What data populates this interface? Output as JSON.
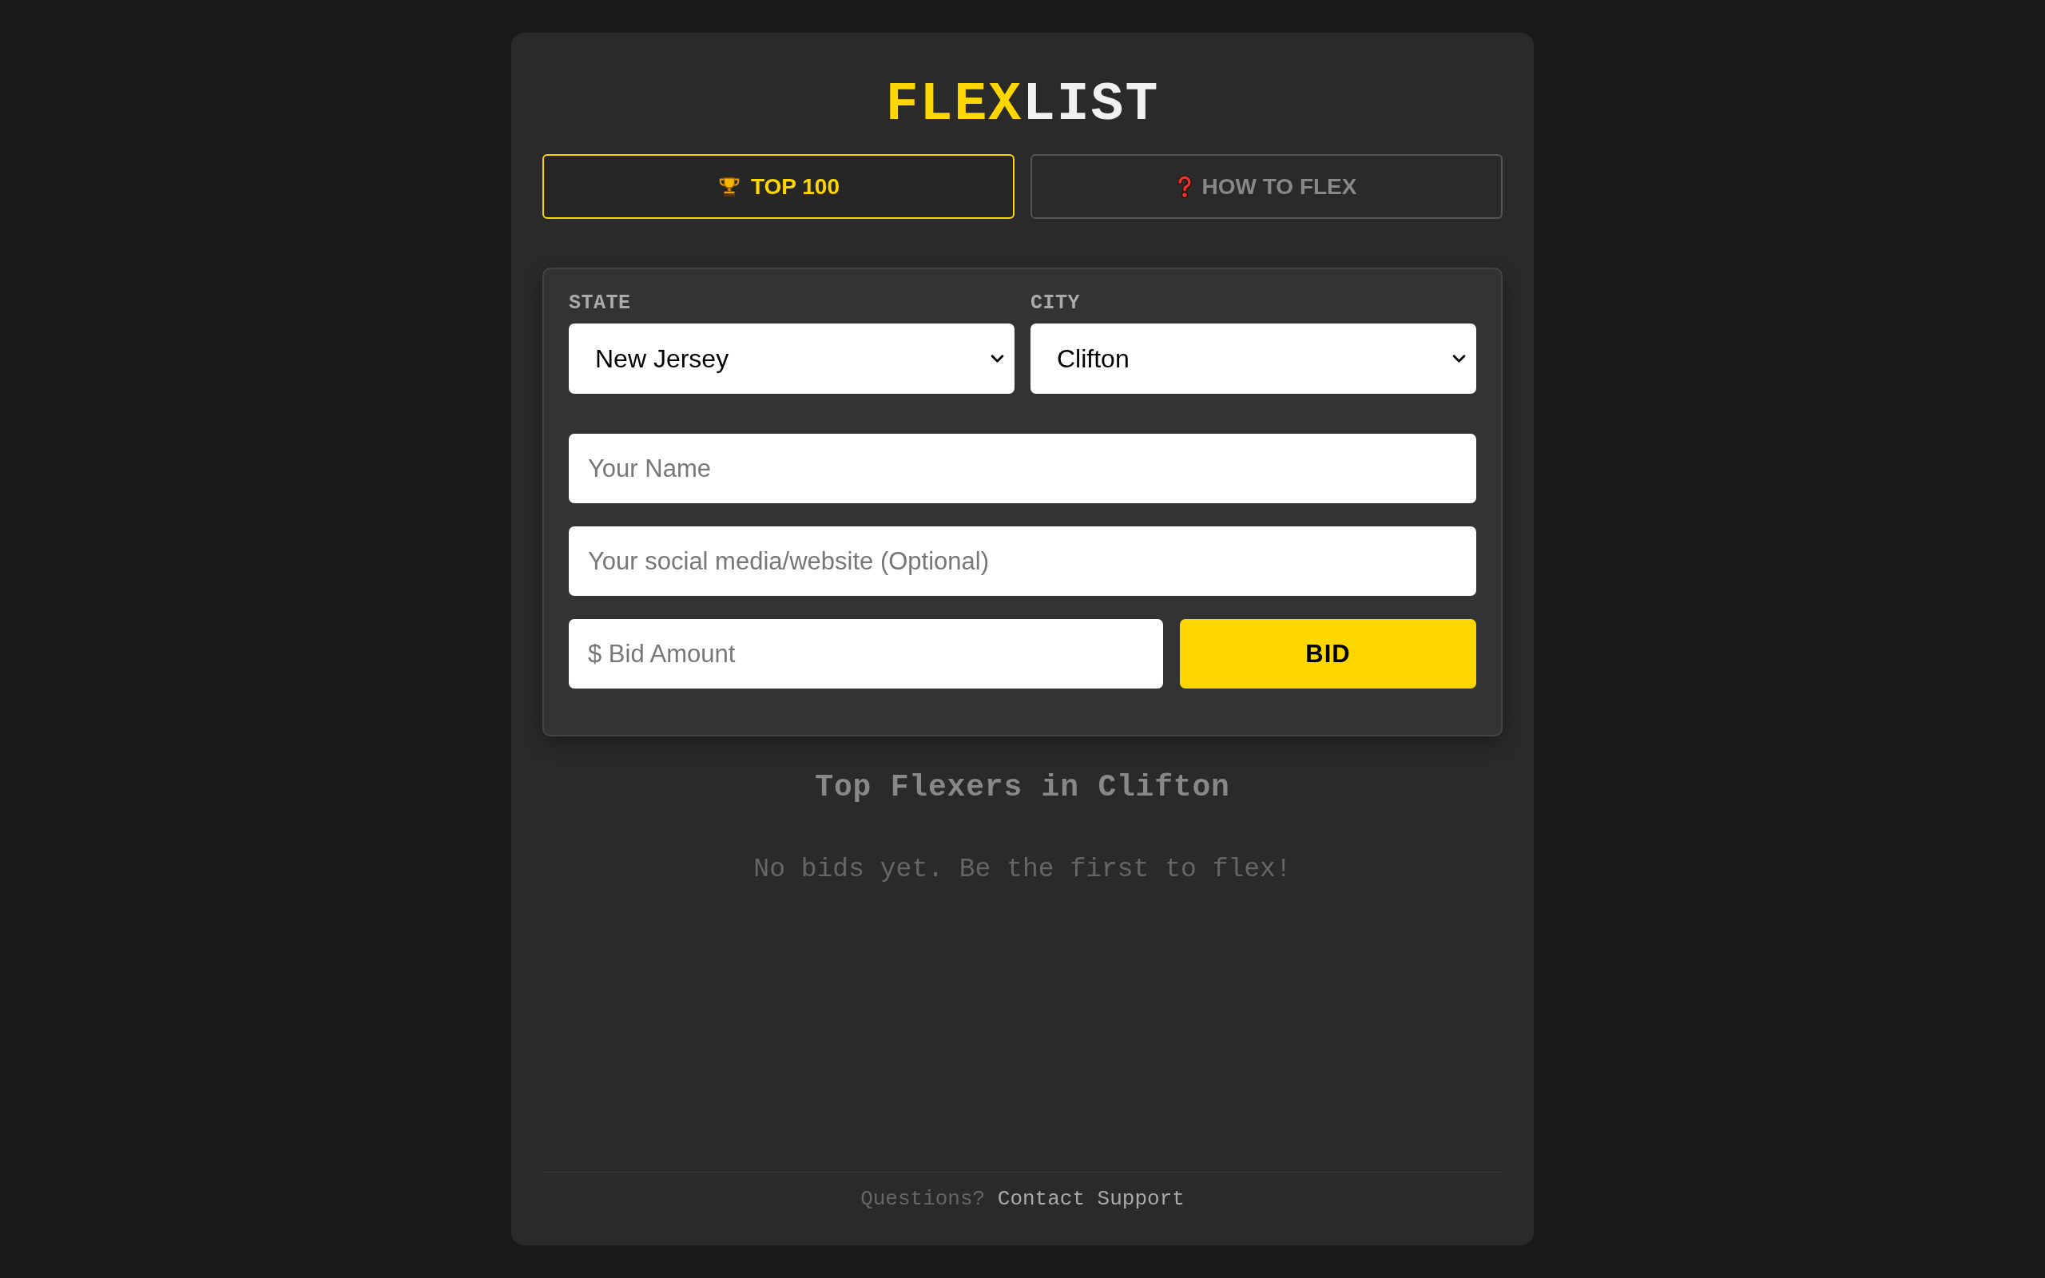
{
  "logo": {
    "accent": "FLEX",
    "text": "LIST"
  },
  "tabs": [
    {
      "label": "TOP 100",
      "selected": true
    },
    {
      "label": "HOW TO FLEX",
      "selected": false
    }
  ],
  "form": {
    "state": {
      "label": "STATE",
      "value": "New Jersey"
    },
    "city": {
      "label": "CITY",
      "value": "Clifton"
    },
    "name_field": {
      "placeholder": "Your Name"
    },
    "social_field": {
      "placeholder": "Your social media/website (Optional)"
    },
    "bid_field": {
      "placeholder": "$ Bid Amount"
    },
    "bid_button": "BID"
  },
  "leaderboard": {
    "title": "Top Flexers in Clifton",
    "empty_message": "No bids yet. Be the first to flex!"
  },
  "footer": {
    "text": "Questions?",
    "link": "Contact Support"
  }
}
